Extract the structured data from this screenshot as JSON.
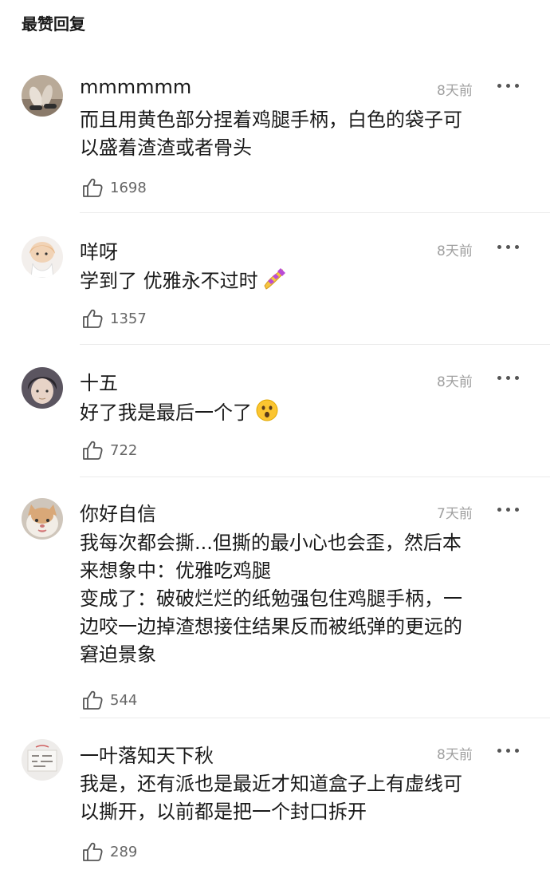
{
  "section_title": "最赞回复",
  "comments": [
    {
      "username": "mmmmmm",
      "time": "8天前",
      "lines": [
        "而且用黄色部分捏着鸡腿手柄，白色的袋子可",
        "以盛着渣渣或者骨头"
      ],
      "likes": "1698"
    },
    {
      "username": "咩呀",
      "time": "8天前",
      "lines": [
        "学到了 优雅永不过时"
      ],
      "emoji": "nail-polish-emoji",
      "likes": "1357"
    },
    {
      "username": "十五",
      "time": "8天前",
      "lines": [
        "好了我是最后一个了"
      ],
      "emoji": "surprised-face-emoji",
      "likes": "722"
    },
    {
      "username": "你好自信",
      "time": "7天前",
      "lines": [
        "我每次都会撕...但撕的最小心也会歪，然后本",
        "来想象中：优雅吃鸡腿",
        "变成了：破破烂烂的纸勉强包住鸡腿手柄，一",
        "边咬一边掉渣想接住结果反而被纸弹的更远的",
        "窘迫景象"
      ],
      "likes": "544"
    },
    {
      "username": "一叶落知天下秋",
      "time": "8天前",
      "lines": [
        "我是，还有派也是最近才知道盒子上有虚线可",
        "以撕开，以前都是把一个封口拆开"
      ],
      "likes": "289"
    }
  ],
  "icons": {
    "like": "thumbs-up-icon",
    "more": "more-options-icon"
  },
  "colors": {
    "text": "#1a1a1a",
    "muted": "#a0a0a0",
    "divider": "#ebebeb"
  }
}
